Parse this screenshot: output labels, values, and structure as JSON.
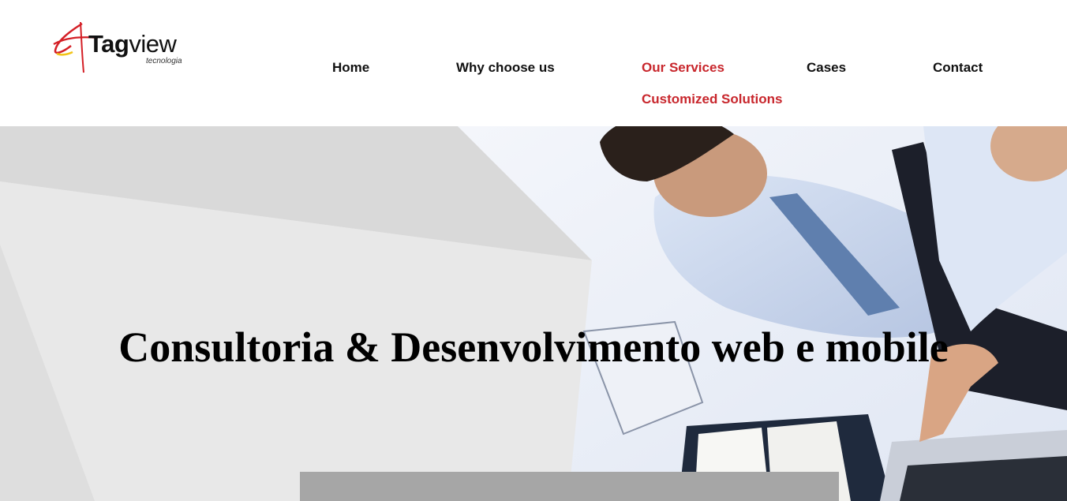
{
  "brand": {
    "name_bold": "Tag",
    "name_regular": "view",
    "tagline": "tecnologia",
    "colors": {
      "red": "#d41f26",
      "yellow": "#f2c418",
      "text": "#111111"
    }
  },
  "nav": {
    "items": [
      {
        "label": "Home",
        "active": false
      },
      {
        "label": "Why choose us",
        "active": false
      },
      {
        "label": "Our Services",
        "active": true
      },
      {
        "label": "Cases",
        "active": false
      },
      {
        "label": "Contact",
        "active": false
      }
    ],
    "submenu": {
      "label": "Customized Solutions"
    },
    "active_color": "#c8262c"
  },
  "hero": {
    "title": "Consultoria & Desenvolvimento web e mobile",
    "image": "business-men-working-at-desk-photo"
  }
}
